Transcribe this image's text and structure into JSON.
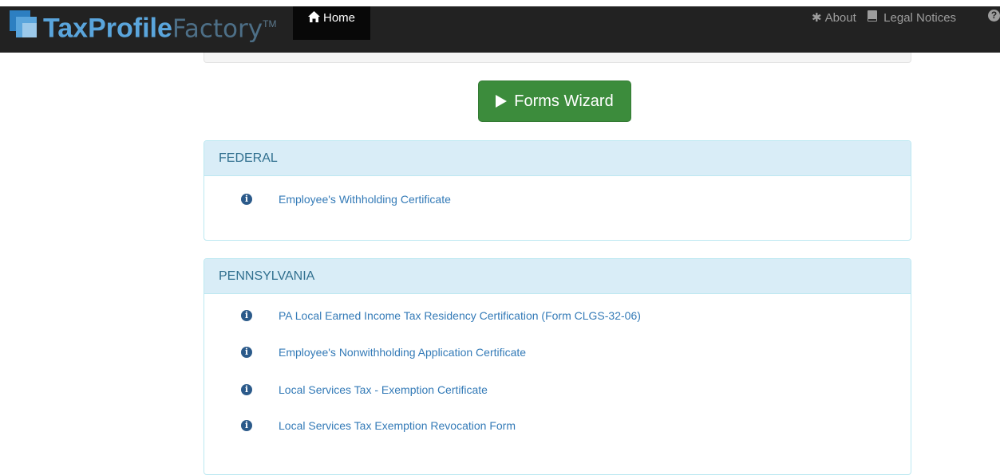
{
  "brand": {
    "name_bold": "TaxProfile",
    "name_light": "Factory",
    "trademark": "TM"
  },
  "nav": {
    "home": {
      "label": "Home",
      "icon": "home-icon"
    },
    "about": {
      "label": "About",
      "icon": "asterisk-icon"
    },
    "legal": {
      "label": "Legal Notices",
      "icon": "book-icon"
    },
    "help": {
      "icon": "question-circle-icon"
    }
  },
  "wizard": {
    "label": "Forms Wizard",
    "icon": "play-icon",
    "color": "#3c8c3c"
  },
  "panels": [
    {
      "title": "FEDERAL",
      "forms": [
        {
          "label": "Employee's Withholding Certificate",
          "icon": "info-circle-icon"
        }
      ]
    },
    {
      "title": "PENNSYLVANIA",
      "forms": [
        {
          "label": "PA Local Earned Income Tax Residency Certification (Form CLGS-32-06)",
          "icon": "info-circle-icon"
        },
        {
          "label": "Employee's Nonwithholding Application Certificate",
          "icon": "info-circle-icon"
        },
        {
          "label": "Local Services Tax - Exemption Certificate",
          "icon": "info-circle-icon"
        },
        {
          "label": "Local Services Tax Exemption Revocation Form",
          "icon": "info-circle-icon"
        }
      ]
    }
  ],
  "colors": {
    "navbar": "#222222",
    "panel_heading_bg": "#d9edf7",
    "panel_heading_text": "#31708f",
    "link": "#337ab7"
  }
}
